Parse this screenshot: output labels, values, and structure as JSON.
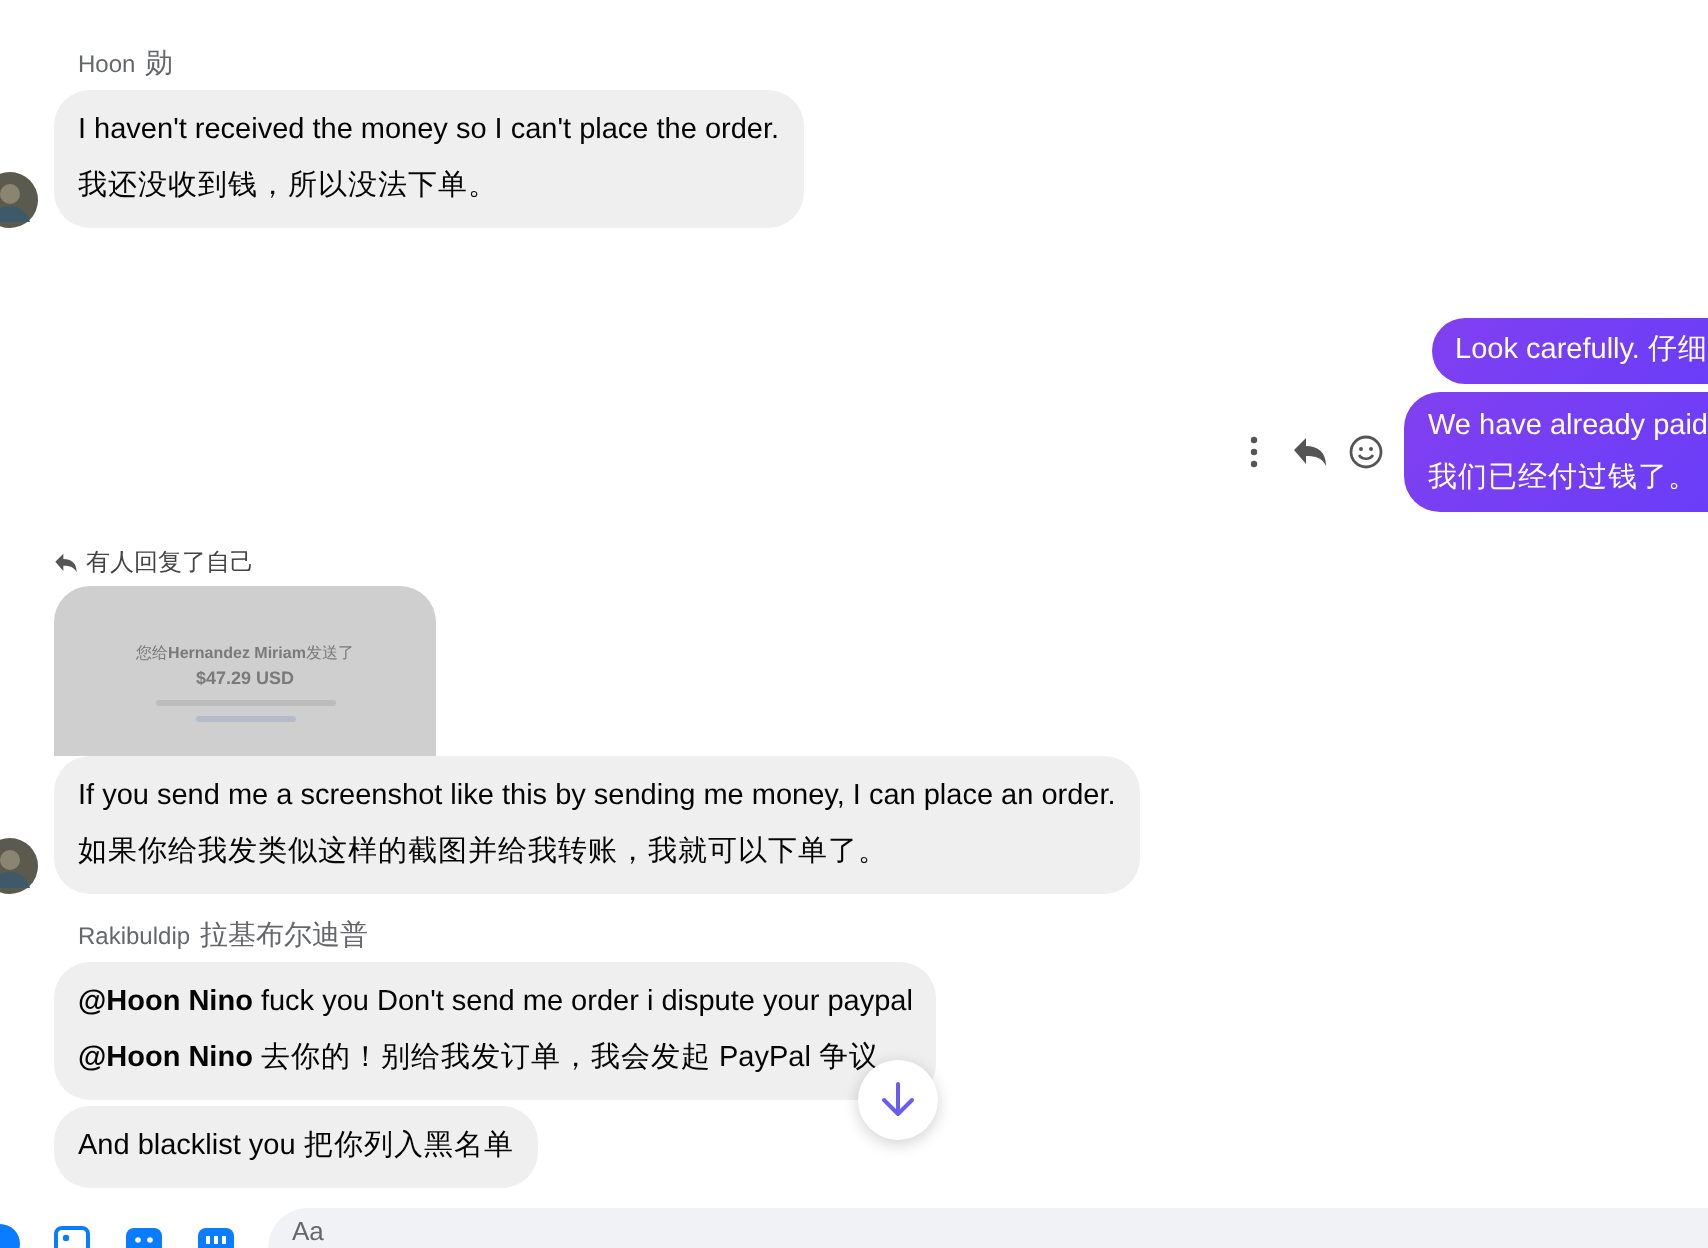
{
  "messages": [
    {
      "kind": "sender",
      "name": "Hoon",
      "alias": "勋"
    },
    {
      "kind": "incoming",
      "avatar": true,
      "lines": [
        "I haven't received the money so I can't place the order.",
        "我还没收到钱，所以没法下单。"
      ]
    },
    {
      "kind": "outgoing",
      "actions": false,
      "lines": [
        "Look carefully.  仔细"
      ]
    },
    {
      "kind": "outgoing",
      "actions": true,
      "lines": [
        "We have already paid",
        "我们已经付过钱了。"
      ]
    },
    {
      "kind": "reply_note",
      "text": "有人回复了自己"
    },
    {
      "kind": "image",
      "lines": [
        "您给**Hernandez Miriam**发送了",
        "$47.29 USD"
      ]
    },
    {
      "kind": "incoming",
      "avatar": true,
      "lines": [
        "If you send me a screenshot like this by sending me money, I can place an order.",
        "如果你给我发类似这样的截图并给我转账，我就可以下单了。"
      ]
    },
    {
      "kind": "sender",
      "name": "Rakibuldip",
      "alias": "拉基布尔迪普"
    },
    {
      "kind": "incoming",
      "avatar": false,
      "lines": [
        "**@Hoon Nino**  fuck you Don't send me order i dispute your paypal",
        "**@Hoon Nino** 去你的！别给我发订单，我会发起 PayPal 争议"
      ]
    },
    {
      "kind": "incoming",
      "avatar": false,
      "lines": [
        "And blacklist you  把你列入黑名单"
      ]
    }
  ],
  "composer": {
    "placeholder": "Aa"
  }
}
